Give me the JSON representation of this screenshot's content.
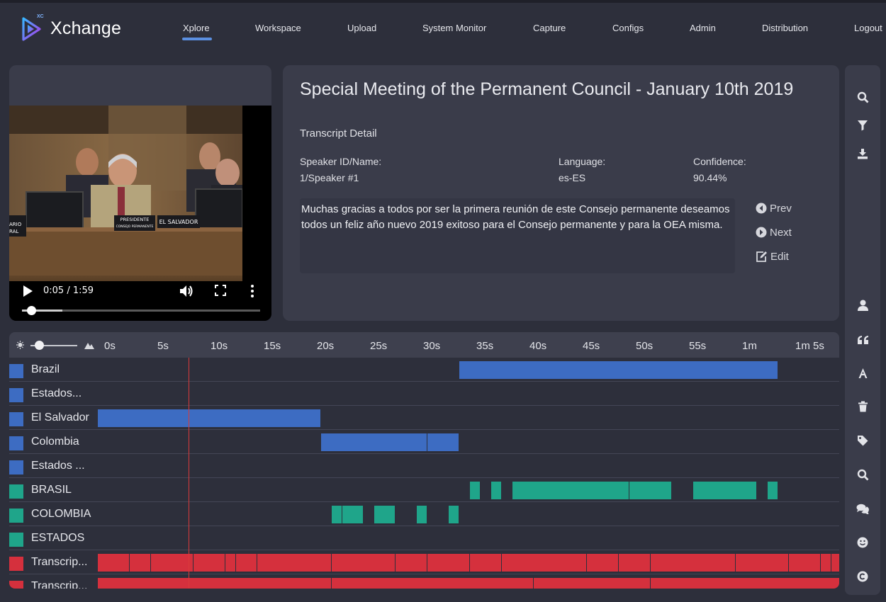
{
  "app": {
    "name": "Xchange",
    "logo_badge": "XC"
  },
  "nav": {
    "items": [
      {
        "label": "Xplore",
        "active": true
      },
      {
        "label": "Workspace"
      },
      {
        "label": "Upload"
      },
      {
        "label": "System Monitor"
      },
      {
        "label": "Capture"
      },
      {
        "label": "Configs"
      },
      {
        "label": "Admin"
      },
      {
        "label": "Distribution"
      },
      {
        "label": "Logout"
      }
    ]
  },
  "video": {
    "time": "0:05 / 1:59",
    "progress": 0.04,
    "buffered": 0.17,
    "placards": [
      "PRESIDENTE",
      "CONSEJO PERMANENTE",
      "EL SALVADOR",
      "ARIO",
      "RAL"
    ]
  },
  "detail": {
    "title": "Special Meeting of the Permanent Council - January 10th 2019",
    "subtitle": "Transcript Detail",
    "speaker_label": "Speaker ID/Name:",
    "speaker_value": "1/Speaker #1",
    "language_label": "Language:",
    "language_value": "es-ES",
    "confidence_label": "Confidence:",
    "confidence_value": "90.44%",
    "text": "Muchas gracias a todos por ser la primera reunión de este Consejo permanente deseamos todos un feliz año nuevo 2019 exitoso para el Consejo permanente y para la OEA misma.",
    "prev_label": "Prev",
    "next_label": "Next",
    "edit_label": "Edit"
  },
  "right_toolbar": {
    "icons": [
      "search-icon",
      "filter-icon",
      "download-icon",
      "user-icon",
      "quote-icon",
      "font-icon",
      "trash-icon",
      "tag-icon",
      "search-alt-icon",
      "comments-icon",
      "smile-icon",
      "copyright-icon"
    ]
  },
  "timeline": {
    "ticks": [
      "0s",
      "5s",
      "10s",
      "15s",
      "20s",
      "25s",
      "30s",
      "35s",
      "40s",
      "45s",
      "50s",
      "55s",
      "1m",
      "1m 5s"
    ],
    "playhead_seconds": 8.5,
    "colors": {
      "blue": "#3d6cc2",
      "teal": "#1fa58a",
      "red": "#d5303d"
    },
    "rows": [
      {
        "label": "Brazil",
        "color": "blue",
        "segments": [
          [
            34,
            64
          ]
        ]
      },
      {
        "label": "Estados...",
        "color": "blue",
        "segments": []
      },
      {
        "label": "El Salvador",
        "color": "blue",
        "segments": [
          [
            0,
            21
          ]
        ]
      },
      {
        "label": "Colombia",
        "color": "blue",
        "segments": [
          [
            21,
            31
          ],
          [
            31,
            34
          ]
        ]
      },
      {
        "label": "Estados ...",
        "color": "blue",
        "segments": []
      },
      {
        "label": "BRASIL",
        "color": "teal",
        "segments": [
          [
            35,
            36
          ],
          [
            37,
            38
          ],
          [
            39,
            50
          ],
          [
            50,
            54
          ],
          [
            56,
            62
          ],
          [
            63,
            64
          ]
        ]
      },
      {
        "label": "COLOMBIA",
        "color": "teal",
        "segments": [
          [
            22,
            23
          ],
          [
            23,
            25
          ],
          [
            26,
            28
          ],
          [
            30,
            31
          ],
          [
            33,
            34
          ]
        ]
      },
      {
        "label": "ESTADOS",
        "color": "teal",
        "segments": []
      },
      {
        "label": "Transcrip...",
        "color": "red",
        "segments": [
          [
            0,
            3
          ],
          [
            3,
            5
          ],
          [
            5,
            9
          ],
          [
            9,
            12
          ],
          [
            12,
            13
          ],
          [
            13,
            15
          ],
          [
            15,
            22
          ],
          [
            22,
            28
          ],
          [
            28,
            31
          ],
          [
            31,
            35
          ],
          [
            35,
            38
          ],
          [
            38,
            46
          ],
          [
            46,
            49
          ],
          [
            49,
            52
          ],
          [
            52,
            60
          ],
          [
            60,
            65
          ],
          [
            65,
            68
          ],
          [
            68,
            69
          ],
          [
            69,
            70
          ]
        ]
      },
      {
        "label": "Transcrip...",
        "color": "red",
        "segments": [
          [
            0,
            22
          ],
          [
            22,
            41
          ],
          [
            41,
            52
          ],
          [
            52,
            70
          ]
        ]
      }
    ]
  }
}
